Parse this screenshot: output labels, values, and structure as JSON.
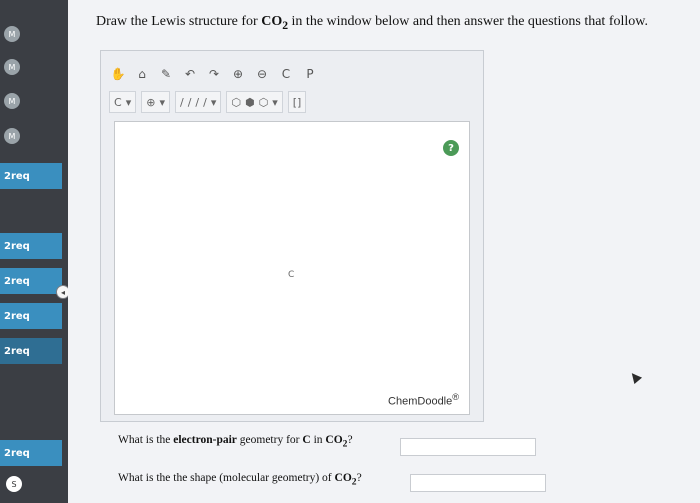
{
  "sidebar": {
    "badges": [
      "M",
      "M",
      "M",
      "M"
    ],
    "items": [
      {
        "label": "2req"
      },
      {
        "label": "2req"
      },
      {
        "label": "2req"
      },
      {
        "label": "2req"
      },
      {
        "label": "2req"
      },
      {
        "label": "2req"
      }
    ],
    "bottom_icons": [
      "S"
    ]
  },
  "main": {
    "title_parts": {
      "pre": "Draw the Lewis structure for ",
      "formula": "CO",
      "sub": "2",
      "post": " in the window below and then answer the questions that follow."
    },
    "editor": {
      "toolbar1": [
        "✋",
        "⌂",
        "✎",
        "↶",
        "↷",
        "⊕",
        "⊖",
        "C",
        "P"
      ],
      "toolbar2": {
        "atom_select": "C",
        "charge_select": "⊕",
        "bond_tools": [
          "/",
          "/",
          "/",
          "/"
        ],
        "ring_tools": [
          "⬡",
          "⬢",
          "⬡"
        ],
        "bracket_tool": "[]"
      },
      "canvas_atom": "C",
      "help": "?",
      "brand": "ChemDoodle",
      "brand_mark": "®"
    },
    "questions": [
      {
        "pre": "What is the ",
        "bold": "electron-pair",
        "mid": " geometry for ",
        "bold2": "C",
        "mid2": " in ",
        "formula": "CO",
        "sub": "2",
        "post": "?"
      },
      {
        "pre": "What is the the shape (molecular geometry) of ",
        "formula": "CO",
        "sub": "2",
        "post": "?"
      }
    ]
  },
  "colors": {
    "sidebar_bg": "#3b3e44",
    "req_bg": "#3a8fbf",
    "help_bg": "#4b9a57"
  }
}
